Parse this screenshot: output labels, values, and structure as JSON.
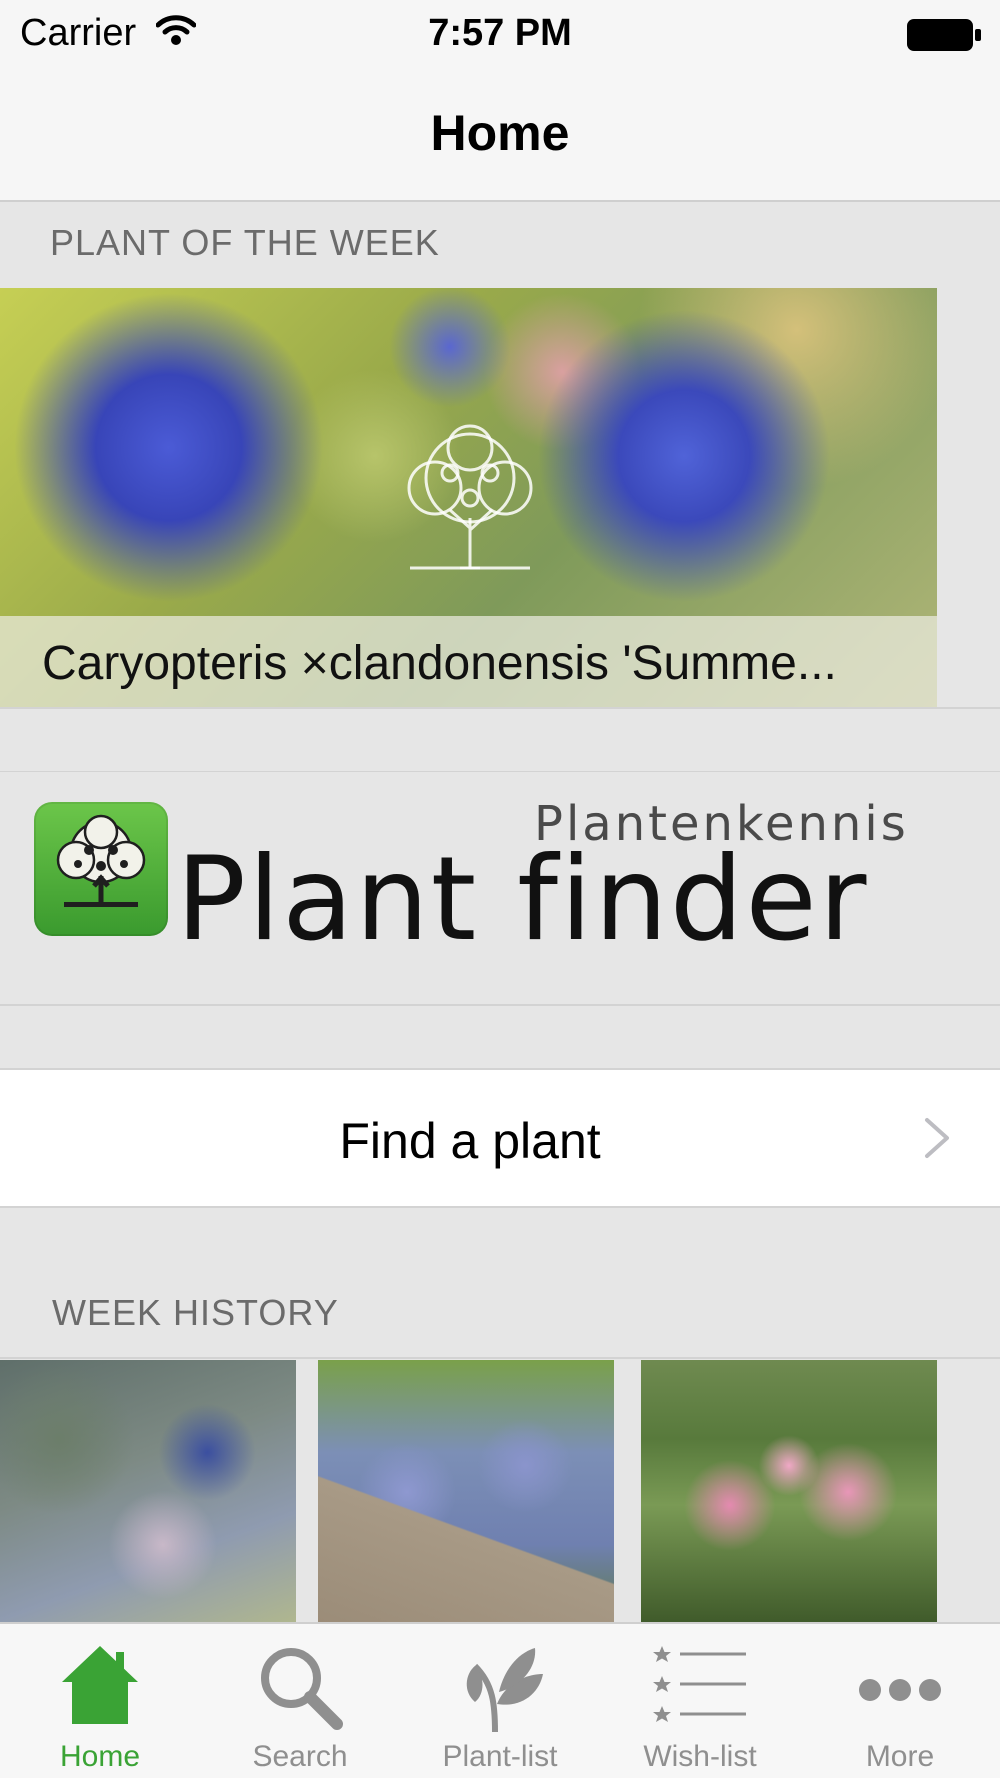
{
  "status_bar": {
    "carrier": "Carrier",
    "time": "7:57 PM"
  },
  "nav": {
    "title": "Home"
  },
  "plant_of_week": {
    "header": "PLANT OF THE WEEK",
    "caption": "Caryopteris ×clandonensis 'Summe..."
  },
  "brand": {
    "subtitle": "Plantenkennis",
    "title": "Plant finder"
  },
  "find": {
    "label": "Find a plant"
  },
  "week_history": {
    "header": "WEEK HISTORY"
  },
  "tabs": [
    {
      "label": "Home",
      "icon": "home-icon",
      "active": true
    },
    {
      "label": "Search",
      "icon": "search-icon",
      "active": false
    },
    {
      "label": "Plant-list",
      "icon": "plant-icon",
      "active": false
    },
    {
      "label": "Wish-list",
      "icon": "star-list-icon",
      "active": false
    },
    {
      "label": "More",
      "icon": "more-icon",
      "active": false
    }
  ],
  "colors": {
    "accent": "#3aa335",
    "tab_inactive": "#8f8f8f",
    "section_header": "#6b6b6b"
  }
}
